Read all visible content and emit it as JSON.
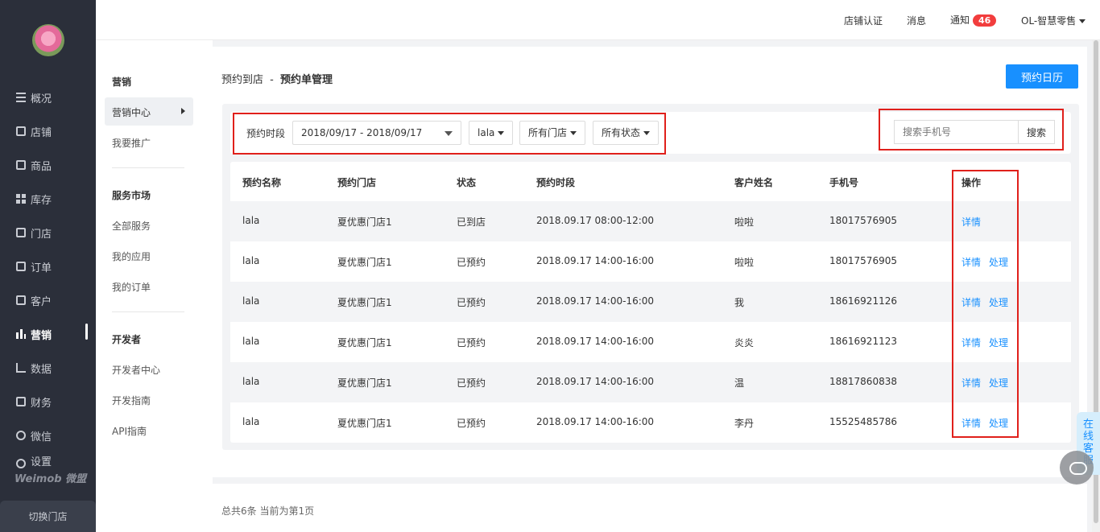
{
  "sidebar": {
    "items": [
      {
        "label": "概况",
        "icon": "overview-icon"
      },
      {
        "label": "店铺",
        "icon": "store-icon"
      },
      {
        "label": "商品",
        "icon": "goods-icon"
      },
      {
        "label": "库存",
        "icon": "inventory-icon"
      },
      {
        "label": "门店",
        "icon": "shop-icon"
      },
      {
        "label": "订单",
        "icon": "order-icon"
      },
      {
        "label": "客户",
        "icon": "customer-icon"
      },
      {
        "label": "营销",
        "icon": "marketing-icon"
      },
      {
        "label": "数据",
        "icon": "data-icon"
      },
      {
        "label": "财务",
        "icon": "finance-icon"
      },
      {
        "label": "微信",
        "icon": "wechat-icon"
      },
      {
        "label": "设置",
        "icon": "settings-icon"
      }
    ],
    "brand": "Weimob 微盟",
    "switch_store": "切换门店"
  },
  "submenu": {
    "group_marketing": "营销",
    "marketing_center": "营销中心",
    "my_promotion": "我要推广",
    "group_service": "服务市场",
    "all_services": "全部服务",
    "my_apps": "我的应用",
    "my_orders": "我的订单",
    "group_developer": "开发者",
    "developer_center": "开发者中心",
    "developer_guide": "开发指南",
    "api_guide": "API指南"
  },
  "header": {
    "store_cert": "店铺认证",
    "messages": "消息",
    "notice": "通知",
    "notice_count": "46",
    "account": "OL-智慧零售"
  },
  "main": {
    "breadcrumb_parent": "预约到店",
    "breadcrumb_sep": "-",
    "breadcrumb_current": "预约单管理",
    "calendar_button": "预约日历"
  },
  "filters": {
    "period_label": "预约时段",
    "date_range": "2018/09/17 - 2018/09/17",
    "name_select": "lala",
    "store_select": "所有门店",
    "status_select": "所有状态",
    "search_placeholder": "搜索手机号",
    "search_button": "搜索"
  },
  "table": {
    "headers": [
      "预约名称",
      "预约门店",
      "状态",
      "预约时段",
      "客户姓名",
      "手机号",
      "操作"
    ],
    "rows": [
      {
        "name": "lala",
        "store": "夏优惠门店1",
        "status": "已到店",
        "period": "2018.09.17 08:00-12:00",
        "customer": "啦啦",
        "phone": "18017576905",
        "actions": [
          "详情"
        ]
      },
      {
        "name": "lala",
        "store": "夏优惠门店1",
        "status": "已预约",
        "period": "2018.09.17 14:00-16:00",
        "customer": "啦啦",
        "phone": "18017576905",
        "actions": [
          "详情",
          "处理"
        ]
      },
      {
        "name": "lala",
        "store": "夏优惠门店1",
        "status": "已预约",
        "period": "2018.09.17 14:00-16:00",
        "customer": "我",
        "phone": "18616921126",
        "actions": [
          "详情",
          "处理"
        ]
      },
      {
        "name": "lala",
        "store": "夏优惠门店1",
        "status": "已预约",
        "period": "2018.09.17 14:00-16:00",
        "customer": "炎炎",
        "phone": "18616921123",
        "actions": [
          "详情",
          "处理"
        ]
      },
      {
        "name": "lala",
        "store": "夏优惠门店1",
        "status": "已预约",
        "period": "2018.09.17 14:00-16:00",
        "customer": "温",
        "phone": "18817860838",
        "actions": [
          "详情",
          "处理"
        ]
      },
      {
        "name": "lala",
        "store": "夏优惠门店1",
        "status": "已预约",
        "period": "2018.09.17 14:00-16:00",
        "customer": "李丹",
        "phone": "15525485786",
        "actions": [
          "详情",
          "处理"
        ]
      }
    ]
  },
  "footer": {
    "summary": "总共6条 当前为第1页"
  },
  "support": {
    "label": "在线客服"
  },
  "colors": {
    "primary": "#1890ff",
    "badge": "#f23d3d",
    "highlight_box": "#e0201b",
    "sidebar_bg": "#2b2f3a"
  }
}
